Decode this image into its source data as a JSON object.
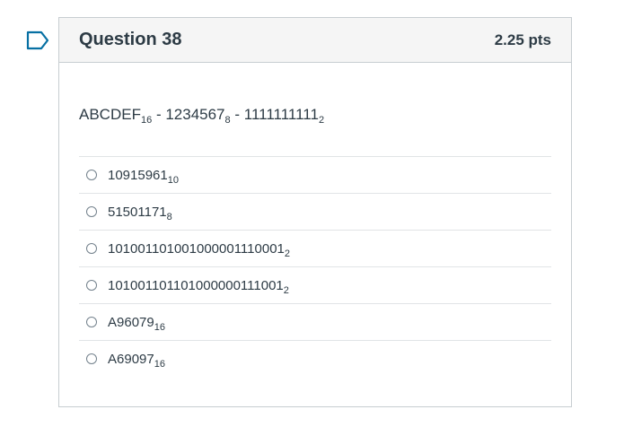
{
  "question": {
    "title": "Question 38",
    "points": "2.25 pts",
    "text": {
      "a": "ABCDEF",
      "a_base": "16",
      "sep1": " - ",
      "b": "1234567",
      "b_base": "8",
      "sep2": " - ",
      "c": "1111111111",
      "c_base": "2"
    },
    "answers": [
      {
        "value": "10915961",
        "base": "10"
      },
      {
        "value": "51501171",
        "base": "8"
      },
      {
        "value": "101001101001000001110001",
        "base": "2"
      },
      {
        "value": "101001101101000000111001",
        "base": "2"
      },
      {
        "value": "A96079",
        "base": "16"
      },
      {
        "value": "A69097",
        "base": "16"
      }
    ]
  },
  "colors": {
    "flag": "#0770a3",
    "header_bg": "#f5f5f5",
    "border": "#c7cdd1",
    "text": "#2d3b45"
  },
  "icons": {
    "flag": "bookmark-flag-icon",
    "radio": "radio-unchecked-icon"
  }
}
